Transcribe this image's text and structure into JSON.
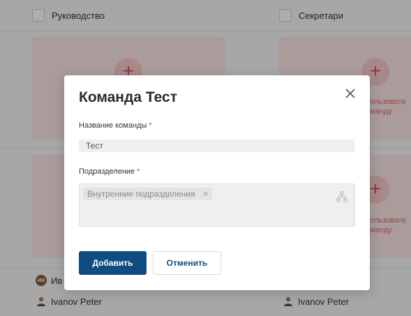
{
  "board": {
    "columns": [
      {
        "title": "Руководство"
      },
      {
        "title": "Секретари"
      }
    ],
    "add_user_text_line1": "ользовате",
    "add_user_text_line2": "манду",
    "plus_glyph": "+",
    "members_left": [
      {
        "badge": "ИИ",
        "name": "Ив"
      },
      {
        "name": "Ivanov Peter"
      }
    ],
    "members_right": [
      {
        "name": "Ivanov Peter"
      }
    ]
  },
  "modal": {
    "title": "Команда Тест",
    "close_glyph": "✕",
    "team_name_label": "Название команды",
    "required_mark": "*",
    "team_name_value": "Тест",
    "division_label": "Подразделение",
    "division_chip": "Внутренние подразделения",
    "chip_remove_glyph": "×",
    "add_button": "Добавить",
    "cancel_button": "Отменить"
  },
  "colors": {
    "primary": "#0f4c81",
    "required": "#e03c3c",
    "card_bg": "#fde6e6",
    "plus_accent": "#e25050"
  },
  "icons": {
    "close": "close-icon",
    "tree": "tree-structure-icon",
    "person": "person-icon",
    "plus": "plus-icon"
  }
}
